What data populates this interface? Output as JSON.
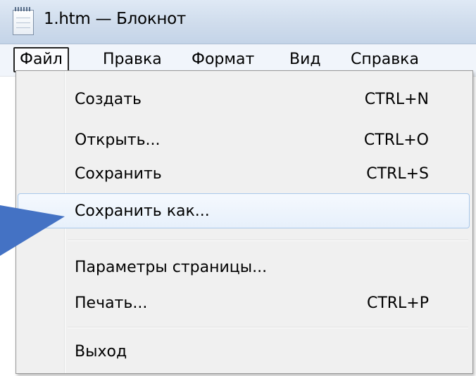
{
  "window": {
    "title": "1.htm — Блокнот",
    "icon": "notepad-icon"
  },
  "menubar": {
    "items": [
      "Файл",
      "Правка",
      "Формат",
      "Вид",
      "Справка"
    ],
    "active": "Файл"
  },
  "file_menu": {
    "items": [
      {
        "label": "Создать",
        "shortcut": "CTRL+N"
      },
      {
        "label": "Открыть...",
        "shortcut": "CTRL+O"
      },
      {
        "label": "Сохранить",
        "shortcut": "CTRL+S"
      },
      {
        "label": "Сохранить как...",
        "shortcut": "",
        "highlighted": true
      },
      {
        "label": "Параметры страницы...",
        "shortcut": ""
      },
      {
        "label": "Печать...",
        "shortcut": "CTRL+P"
      },
      {
        "label": "Выход",
        "shortcut": ""
      }
    ]
  },
  "annotation": {
    "pointer_color": "#4472c4",
    "pointer_icon": "arrow-pointer-icon"
  }
}
